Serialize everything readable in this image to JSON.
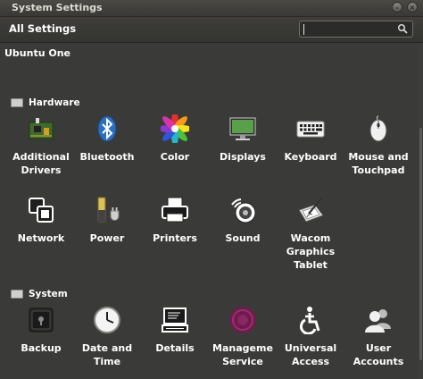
{
  "window": {
    "title": "System Settings"
  },
  "toolbar": {
    "all_settings": "All Settings",
    "search_value": ""
  },
  "top_items": [
    {
      "label": "Ubuntu One"
    }
  ],
  "hardware": {
    "title": "Hardware",
    "items": [
      {
        "label": "Additional Drivers"
      },
      {
        "label": "Bluetooth"
      },
      {
        "label": "Color"
      },
      {
        "label": "Displays"
      },
      {
        "label": "Keyboard"
      },
      {
        "label": "Mouse and Touchpad"
      },
      {
        "label": "Network"
      },
      {
        "label": "Power"
      },
      {
        "label": "Printers"
      },
      {
        "label": "Sound"
      },
      {
        "label": "Wacom Graphics Tablet"
      }
    ]
  },
  "system": {
    "title": "System",
    "items": [
      {
        "label": "Backup"
      },
      {
        "label": "Date and Time"
      },
      {
        "label": "Details"
      },
      {
        "label": "Manageme Service"
      },
      {
        "label": "Universal Access"
      },
      {
        "label": "User Accounts"
      }
    ]
  },
  "colors": {
    "background": "#3a3a38",
    "accent_management": "#7a1f55"
  }
}
